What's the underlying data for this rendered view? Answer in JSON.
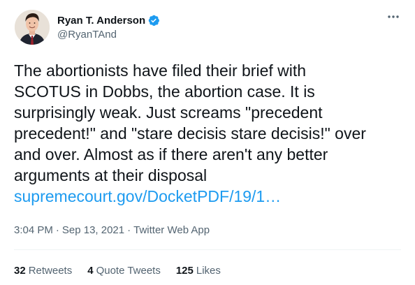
{
  "author": {
    "display_name": "Ryan T. Anderson",
    "handle": "@RyanTAnd",
    "verified": true
  },
  "tweet": {
    "text": "The abortionists have filed their brief with\nSCOTUS in Dobbs, the abortion case. It is\nsurprisingly weak. Just screams \"precedent\nprecedent!\" and \"stare decisis stare decisis!\" over\nand over. Almost as if there aren't any better\narguments at their disposal",
    "link_text": "supremecourt.gov/DocketPDF/19/1…"
  },
  "meta": {
    "time": "3:04 PM",
    "separator": "·",
    "date": "Sep 13, 2021",
    "app": "Twitter Web App"
  },
  "stats": {
    "retweets": {
      "count": "32",
      "label": "Retweets"
    },
    "quotes": {
      "count": "4",
      "label": "Quote Tweets"
    },
    "likes": {
      "count": "125",
      "label": "Likes"
    }
  },
  "colors": {
    "link": "#1d9bf0",
    "verified_badge": "#1d9bf0",
    "secondary_text": "#536471",
    "primary_text": "#0f1419"
  },
  "icons": {
    "verified": "verified-badge-icon",
    "more": "more-options-icon"
  }
}
